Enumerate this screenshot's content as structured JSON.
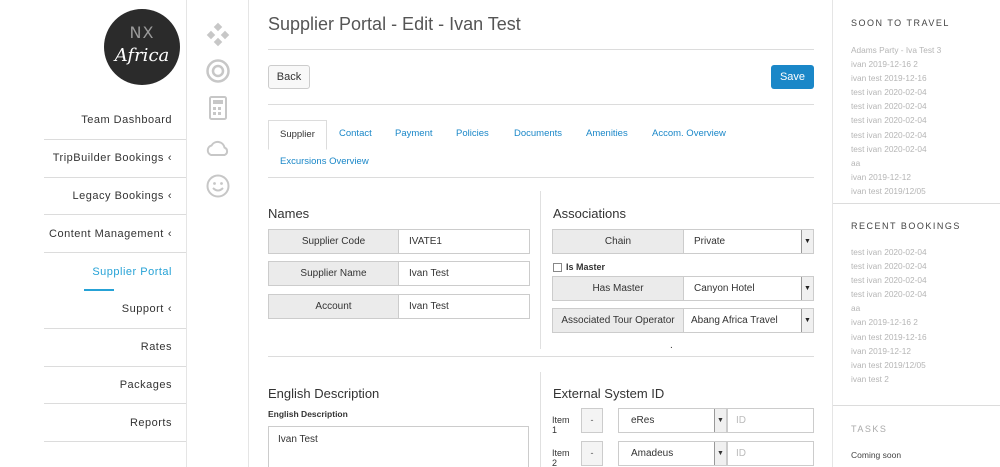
{
  "logo": {
    "line1": "NX",
    "line2": "Africa"
  },
  "nav": {
    "items": [
      {
        "label": "Team Dashboard",
        "arrow": false
      },
      {
        "label": "TripBuilder Bookings",
        "arrow": true
      },
      {
        "label": "Legacy Bookings",
        "arrow": true
      },
      {
        "label": "Content Management",
        "arrow": true
      },
      {
        "label": "Supplier Portal",
        "arrow": false,
        "active": true
      },
      {
        "label": "Support",
        "arrow": true
      },
      {
        "label": "Rates",
        "arrow": false
      },
      {
        "label": "Packages",
        "arrow": false
      },
      {
        "label": "Reports",
        "arrow": false
      }
    ],
    "arrow_glyph": "‹"
  },
  "rail_icons": [
    "puzzle-icon",
    "lifebuoy-icon",
    "calculator-icon",
    "cloud-icon",
    "smiley-icon"
  ],
  "page": {
    "title": "Supplier Portal - Edit - Ivan Test",
    "back_label": "Back",
    "save_label": "Save",
    "accent": "#1a87c8",
    "tabs": [
      "Supplier",
      "Contact",
      "Payment",
      "Policies",
      "Documents",
      "Amenities",
      "Accom. Overview",
      "Excursions Overview"
    ],
    "active_tab": "Supplier"
  },
  "names": {
    "title": "Names",
    "code_label": "Supplier Code",
    "code_value": "IVATE1",
    "name_label": "Supplier Name",
    "name_value": "Ivan Test",
    "account_label": "Account",
    "account_value": "Ivan Test"
  },
  "associations": {
    "title": "Associations",
    "chain_label": "Chain",
    "chain_value": "Private",
    "is_master_label": "Is Master",
    "has_master_label": "Has Master",
    "has_master_value": "Canyon Hotel",
    "tour_op_label": "Associated Tour Operator",
    "tour_op_value": "Abang Africa Travel",
    "dot": "."
  },
  "english": {
    "title": "English Description",
    "sublabel": "English Description",
    "value": "Ivan Test"
  },
  "external": {
    "title": "External System ID",
    "rows": [
      {
        "item": "Item 1",
        "minus": "-",
        "system": "eRes",
        "id_placeholder": "ID"
      },
      {
        "item": "Item 2",
        "minus": "-",
        "system": "Amadeus",
        "id_placeholder": "ID"
      }
    ]
  },
  "right": {
    "soon_title": "SOON TO TRAVEL",
    "soon_items": [
      "Adams Party - Iva Test 3",
      "ivan 2019-12-16 2",
      "ivan test 2019-12-16",
      "test ivan 2020-02-04",
      "test ivan 2020-02-04",
      "test ivan 2020-02-04",
      "test ivan 2020-02-04",
      "test ivan 2020-02-04",
      "aa",
      "ivan 2019-12-12",
      "ivan test 2019/12/05"
    ],
    "recent_title": "RECENT BOOKINGS",
    "recent_items": [
      "test ivan 2020-02-04",
      "test ivan 2020-02-04",
      "test ivan 2020-02-04",
      "test ivan 2020-02-04",
      "aa",
      "ivan 2019-12-16 2",
      "ivan test 2019-12-16",
      "ivan 2019-12-12",
      "ivan test 2019/12/05",
      "ivan test 2"
    ],
    "tasks_title": "TASKS",
    "tasks_value": "Coming soon"
  }
}
